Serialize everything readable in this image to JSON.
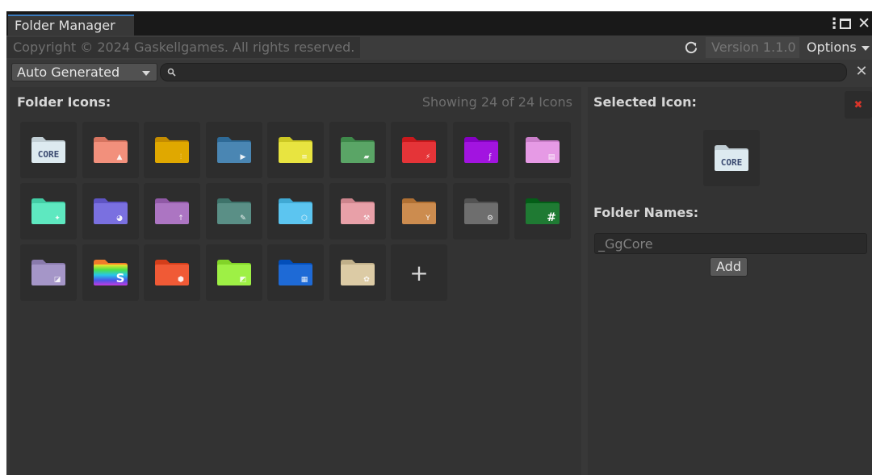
{
  "window": {
    "tab_title": "Folder Manager",
    "controls": {
      "more_icon": "kebab-menu-icon",
      "maximize_icon": "maximize-icon",
      "close_icon": "close-icon"
    }
  },
  "header": {
    "copyright": "Copyright © 2024 Gaskellgames. All rights reserved.",
    "refresh_icon": "refresh-icon",
    "version": "Version 1.1.0",
    "options_label": "Options"
  },
  "toolbar": {
    "dropdown_value": "Auto Generated",
    "search_value": "",
    "search_placeholder": ""
  },
  "icons_panel": {
    "title": "Folder Icons:",
    "count_text": "Showing 24 of 24 Icons",
    "icons": [
      {
        "name": "core-folder-icon",
        "color": "#ddeaf0",
        "badge": "CORE"
      },
      {
        "name": "art-folder-icon",
        "color": "#f2907c",
        "badge": "▲"
      },
      {
        "name": "audio-mixer-folder-icon",
        "color": "#e0a800",
        "badge": "⫶"
      },
      {
        "name": "video-folder-icon",
        "color": "#4a86b3",
        "badge": "▶"
      },
      {
        "name": "document-folder-icon",
        "color": "#e8e440",
        "badge": "≡"
      },
      {
        "name": "data-folder-icon",
        "color": "#5aa566",
        "badge": "▰"
      },
      {
        "name": "editor-folder-icon",
        "color": "#e53438",
        "badge": "⚡"
      },
      {
        "name": "script-folder-icon",
        "color": "#a214e0",
        "badge": "ƒ"
      },
      {
        "name": "image-folder-icon",
        "color": "#e69ae5",
        "badge": "▤"
      },
      {
        "name": "physics-folder-icon",
        "color": "#5ee8c0",
        "badge": "✦"
      },
      {
        "name": "materials-folder-icon",
        "color": "#7a70e0",
        "badge": "◕"
      },
      {
        "name": "upload-folder-icon",
        "color": "#ac75c2",
        "badge": "↑"
      },
      {
        "name": "tools-folder-icon",
        "color": "#5a8f86",
        "badge": "✎"
      },
      {
        "name": "prefab-folder-icon",
        "color": "#5cc5f0",
        "badge": "⬡"
      },
      {
        "name": "plugins-folder-icon",
        "color": "#e8a0a8",
        "badge": "⚒"
      },
      {
        "name": "archive-folder-icon",
        "color": "#cc8c4f",
        "badge": "Y"
      },
      {
        "name": "settings-folder-icon",
        "color": "#6e6e6e",
        "badge": "⚙"
      },
      {
        "name": "csharp-folder-icon",
        "color": "#1f7a33",
        "badge": "#"
      },
      {
        "name": "scenes-folder-icon",
        "color": "#a596c8",
        "badge": "◪"
      },
      {
        "name": "shaders-folder-icon",
        "color": "rainbow",
        "badge": "S"
      },
      {
        "name": "models-folder-icon",
        "color": "#f05a36",
        "badge": "⬢"
      },
      {
        "name": "textures-folder-icon",
        "color": "#9ef045",
        "badge": "◩"
      },
      {
        "name": "tiles-folder-icon",
        "color": "#1e6ad6",
        "badge": "▦"
      },
      {
        "name": "resources-folder-icon",
        "color": "#dccba5",
        "badge": "✿"
      }
    ],
    "add_label": "+"
  },
  "selected_panel": {
    "title": "Selected Icon:",
    "delete_label": "✖",
    "preview_badge": "CORE",
    "names_title": "Folder Names:",
    "name_value": "_GgCore",
    "add_button": "Add"
  }
}
